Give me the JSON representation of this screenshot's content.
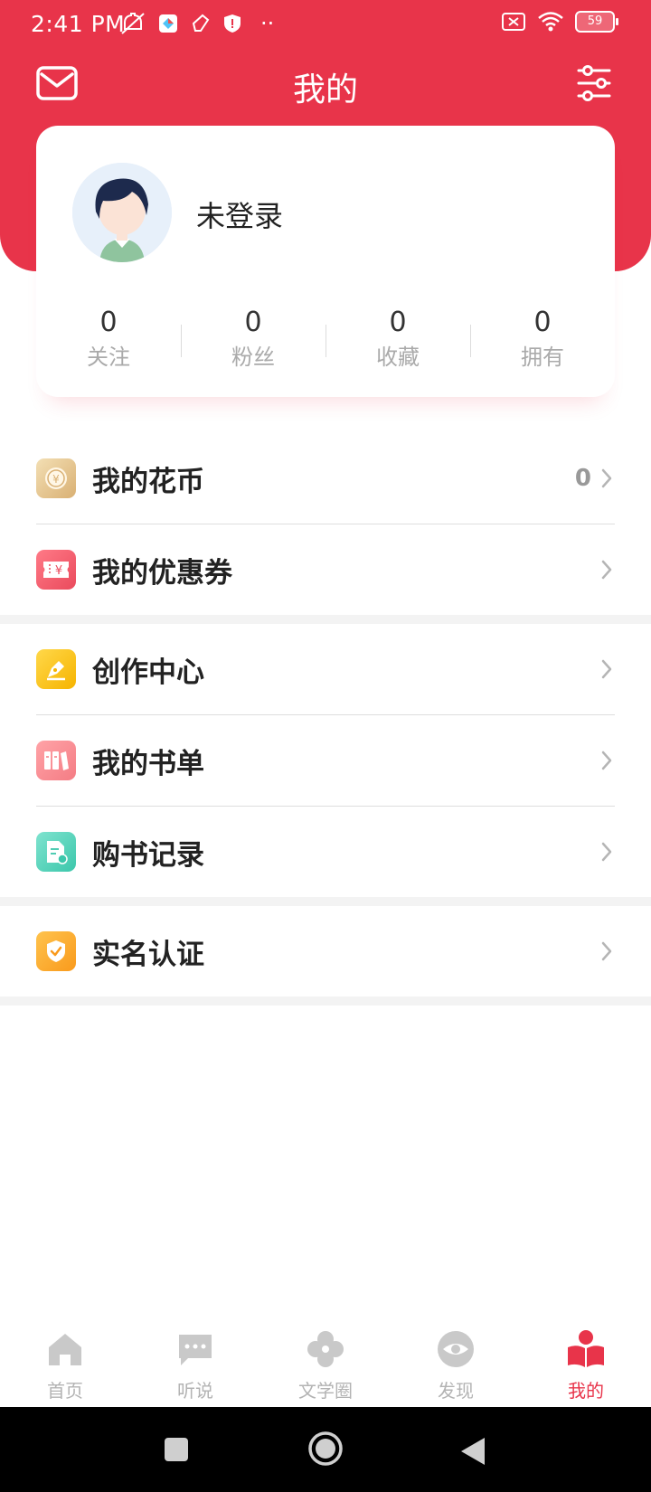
{
  "status_bar": {
    "time": "2:41 PM",
    "dots": "··",
    "battery": "59"
  },
  "header": {
    "title": "我的"
  },
  "profile": {
    "login_label": "未登录",
    "stats": [
      {
        "value": "0",
        "label": "关注"
      },
      {
        "value": "0",
        "label": "粉丝"
      },
      {
        "value": "0",
        "label": "收藏"
      },
      {
        "value": "0",
        "label": "拥有"
      }
    ]
  },
  "menu": {
    "group1": [
      {
        "label": "我的花币",
        "value": "0",
        "icon": "coin-icon"
      },
      {
        "label": "我的优惠券",
        "icon": "coupon-icon"
      }
    ],
    "group2": [
      {
        "label": "创作中心",
        "icon": "pen-icon"
      },
      {
        "label": "我的书单",
        "icon": "books-icon"
      },
      {
        "label": "购书记录",
        "icon": "receipt-icon"
      }
    ],
    "group3": [
      {
        "label": "实名认证",
        "icon": "shield-check-icon"
      }
    ]
  },
  "tabs": [
    {
      "label": "首页",
      "icon": "home-icon",
      "active": false
    },
    {
      "label": "听说",
      "icon": "chat-icon",
      "active": false
    },
    {
      "label": "文学圈",
      "icon": "clover-icon",
      "active": false
    },
    {
      "label": "发现",
      "icon": "eye-icon",
      "active": false
    },
    {
      "label": "我的",
      "icon": "reader-icon",
      "active": true
    }
  ],
  "colors": {
    "brand": "#e8344a",
    "inactive_tab": "#b3b3b3"
  }
}
